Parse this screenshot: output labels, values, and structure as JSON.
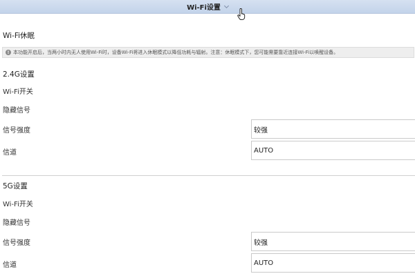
{
  "header": {
    "title": "Wi-Fi设置"
  },
  "wifi_sleep": {
    "title": "Wi-Fi休眠",
    "notice": "本功能开启后，当两小时内无人使用Wi-Fi时，设备Wi-Fi将进入休眠模式以降低功耗与辐射。注意：休眠模式下，您可能需要靠近连接Wi-Fi以唤醒设备。"
  },
  "band_24g": {
    "title": "2.4G设置",
    "wifi_switch_label": "Wi-Fi开关",
    "hide_ssid_label": "隐藏信号",
    "signal_strength_label": "信号强度",
    "signal_strength_value": "较强",
    "channel_label": "信道",
    "channel_value": "AUTO"
  },
  "band_5g": {
    "title": "5G设置",
    "wifi_switch_label": "Wi-Fi开关",
    "hide_ssid_label": "隐藏信号",
    "signal_strength_label": "信号强度",
    "signal_strength_value": "较强",
    "channel_label": "信道",
    "channel_value": "AUTO"
  },
  "icons": {
    "header_expand": "chevron-down-icon",
    "notice": "info-icon",
    "pointer": "hand-pointer-icon"
  }
}
